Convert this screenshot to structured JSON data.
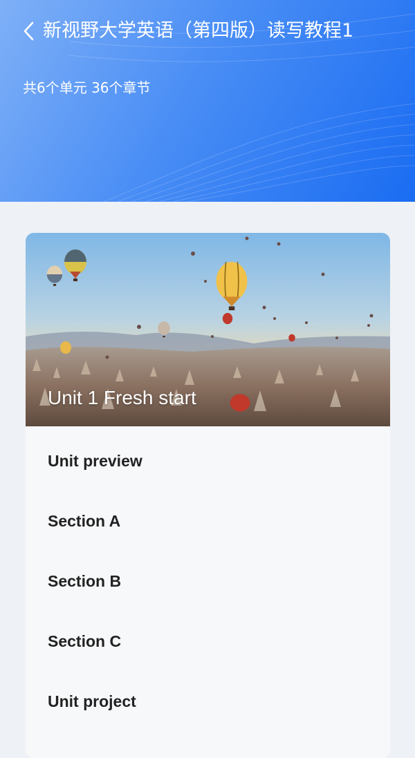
{
  "header": {
    "title": "新视野大学英语（第四版）读写教程1",
    "subtitle": "共6个单元 36个章节",
    "back_icon": "chevron-left-icon",
    "gradient_start": "#7fb0f7",
    "gradient_end": "#1a6cf2"
  },
  "unit": {
    "title": "Unit 1 Fresh start",
    "banner_image": "hot-air-balloons-landscape"
  },
  "chapters": [
    {
      "label": "Unit preview"
    },
    {
      "label": "Section A"
    },
    {
      "label": "Section B"
    },
    {
      "label": "Section C"
    },
    {
      "label": "Unit project"
    }
  ]
}
